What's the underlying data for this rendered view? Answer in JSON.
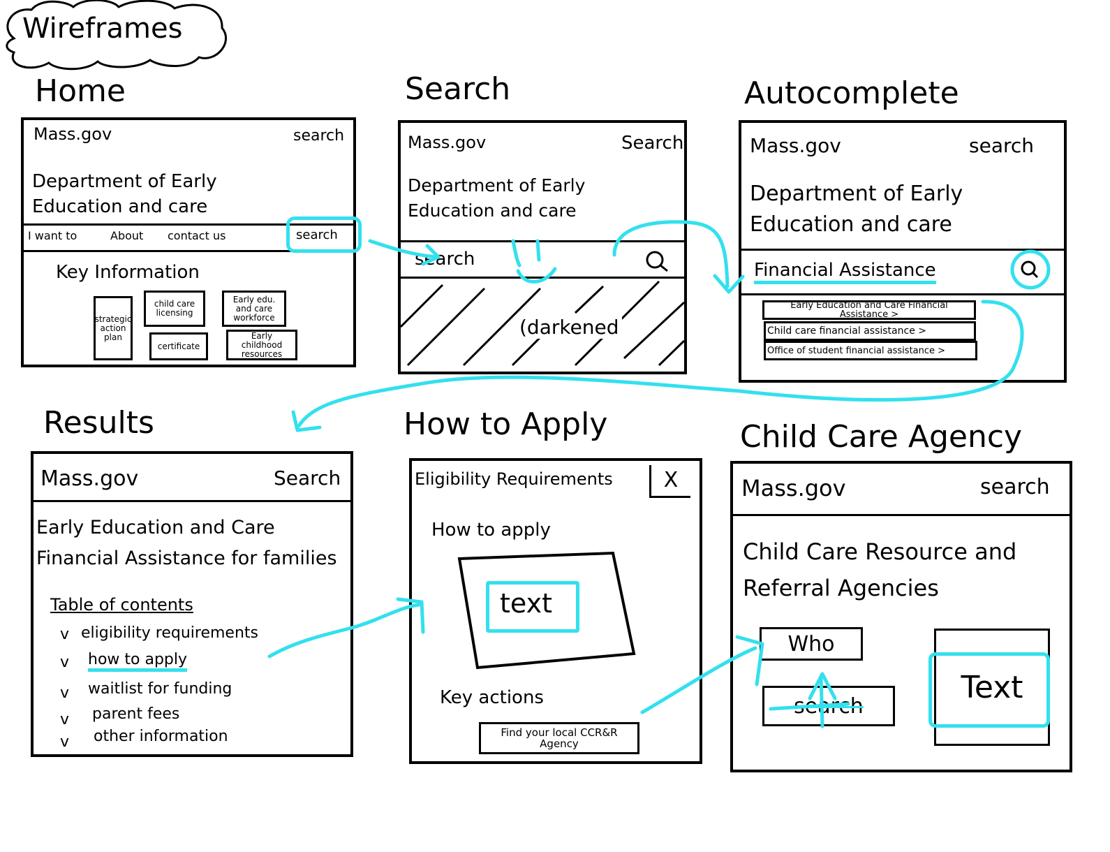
{
  "badge": "Wireframes",
  "colors": {
    "ink": "#000000",
    "annotation": "#33e0ee",
    "background": "#ffffff"
  },
  "home": {
    "title": "Home",
    "site": "Mass.gov",
    "search": "search",
    "dept": "Department of Early Education and care",
    "nav": [
      "I want to",
      "About",
      "contact us"
    ],
    "nav_search": "search",
    "section": "Key Information",
    "cards": [
      "strategic action plan",
      "child care licensing",
      "Early edu. and care workforce",
      "certificate",
      "Early childhood resources"
    ]
  },
  "search": {
    "title": "Search",
    "site": "Mass.gov",
    "search": "Search",
    "dept": "Department of Early Education and care",
    "input": "search",
    "search_icon": "magnifier-icon",
    "overlay": "(darkened"
  },
  "autocomplete": {
    "title": "Autocomplete",
    "site": "Mass.gov",
    "search": "search",
    "dept": "Department of Early Education and care",
    "query": "Financial Assistance",
    "suggestions": [
      "Early Education and Care Financial Assistance >",
      "Child care financial assistance >",
      "Office of student financial assistance >"
    ]
  },
  "results": {
    "title": "Results",
    "site": "Mass.gov",
    "search": "Search",
    "heading": "Early Education and Care Financial Assistance for families",
    "toc_title": "Table of contents",
    "toc": [
      "eligibility requirements",
      "how to apply",
      "waitlist for funding",
      "parent fees",
      "other information"
    ]
  },
  "apply": {
    "title": "How to Apply",
    "header": "Eligibility Requirements",
    "close": "X",
    "subtitle": "How to apply",
    "text": "text",
    "key_actions": "Key actions",
    "button": "Find your local CCR&R Agency"
  },
  "agency": {
    "title": "Child Care Agency",
    "site": "Mass.gov",
    "search": "search",
    "heading": "Child Care Resource and Referral Agencies",
    "who": "Who",
    "search_box": "search",
    "text": "Text"
  }
}
